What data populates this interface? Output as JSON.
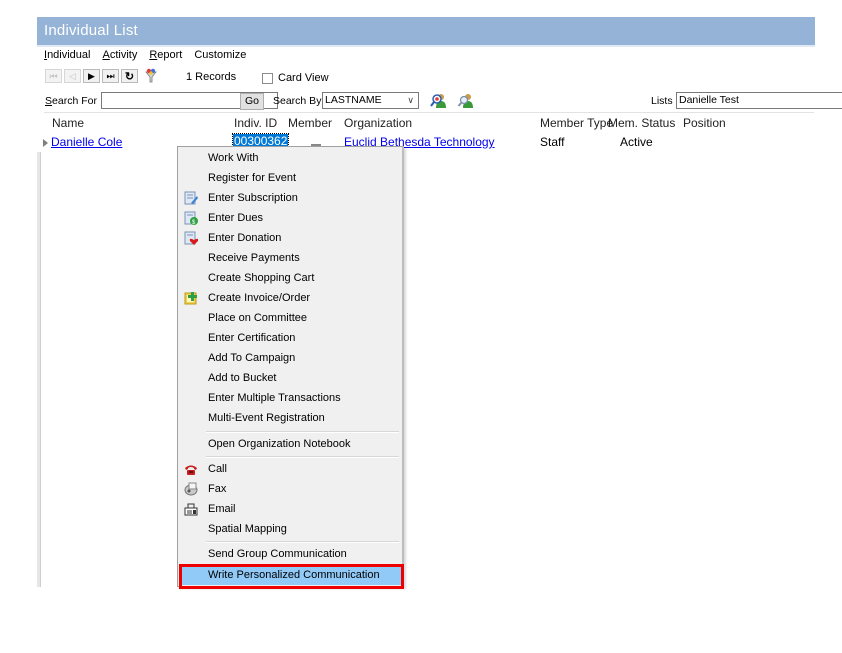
{
  "window": {
    "title": "Individual List"
  },
  "menu": [
    {
      "label": "Individual",
      "accel": "I",
      "rest": "ndividual"
    },
    {
      "label": "Activity",
      "accel": "A",
      "rest": "ctivity"
    },
    {
      "label": "Report",
      "accel": "R",
      "rest": "eport"
    },
    {
      "label": "Customize",
      "accel": "",
      "rest": "Customize"
    }
  ],
  "toolbar": {
    "nav_buttons": [
      {
        "name": "first-record",
        "glyph": "⏮",
        "enabled": false
      },
      {
        "name": "previous-record",
        "glyph": "◁",
        "enabled": false
      },
      {
        "name": "next-record",
        "glyph": "▶",
        "enabled": true
      },
      {
        "name": "last-record",
        "glyph": "⏭",
        "enabled": true
      },
      {
        "name": "refresh",
        "glyph": "↻",
        "enabled": true
      }
    ],
    "records_label": "1 Records",
    "card_view_label": "Card View",
    "card_view_checked": false
  },
  "search": {
    "search_for_label": "Search For",
    "search_for_value": "",
    "go_label": "Go",
    "search_by_label": "Search By",
    "search_by_value": "LASTNAME",
    "lists_label": "Lists",
    "lists_value": "Danielle Test"
  },
  "grid": {
    "columns": [
      "Name",
      "Indiv. ID",
      "Member",
      "Organization",
      "Member Type",
      "Mem. Status",
      "Position"
    ],
    "rows": [
      {
        "name": "Danielle Cole",
        "indiv_id": "00300362",
        "member": "",
        "organization": "Euclid Bethesda Technology",
        "member_type": "Staff",
        "mem_status": "Active",
        "position": ""
      }
    ]
  },
  "context_menu": {
    "items": [
      {
        "label": "Work With",
        "icon": ""
      },
      {
        "label": "Register for Event",
        "icon": ""
      },
      {
        "label": "Enter Subscription",
        "icon": "subscription-icon"
      },
      {
        "label": "Enter Dues",
        "icon": "dues-icon"
      },
      {
        "label": "Enter Donation",
        "icon": "donation-icon"
      },
      {
        "label": "Receive Payments",
        "icon": ""
      },
      {
        "label": "Create Shopping Cart",
        "icon": ""
      },
      {
        "label": "Create Invoice/Order",
        "icon": "invoice-icon"
      },
      {
        "label": "Place on Committee",
        "icon": ""
      },
      {
        "label": "Enter Certification",
        "icon": ""
      },
      {
        "label": "Add To Campaign",
        "icon": ""
      },
      {
        "label": "Add to Bucket",
        "icon": ""
      },
      {
        "label": "Enter Multiple Transactions",
        "icon": ""
      },
      {
        "label": "Multi-Event Registration",
        "icon": ""
      },
      {
        "label": "Open Organization Notebook",
        "icon": ""
      },
      {
        "label": "Call",
        "icon": "phone-icon"
      },
      {
        "label": "Fax",
        "icon": "fax-icon"
      },
      {
        "label": "Email",
        "icon": "email-icon"
      },
      {
        "label": "Spatial Mapping",
        "icon": ""
      },
      {
        "label": "Send Group Communication",
        "icon": ""
      },
      {
        "label": "Write Personalized Communication",
        "icon": "",
        "highlighted": true
      }
    ]
  },
  "colors": {
    "title_bar": "#95b3d7",
    "selection": "#0078d7",
    "menu_highlight": "#91c9f7",
    "annotation_box": "#ee0000",
    "link": "#0000ee"
  }
}
